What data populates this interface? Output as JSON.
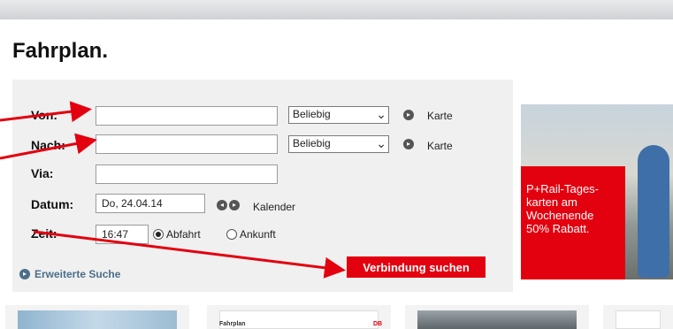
{
  "page": {
    "title": "Fahrplan."
  },
  "form": {
    "von_label": "Von:",
    "nach_label": "Nach:",
    "via_label": "Via:",
    "datum_label": "Datum:",
    "zeit_label": "Zeit:",
    "von_value": "",
    "nach_value": "",
    "via_value": "",
    "datum_value": "Do, 24.04.14",
    "zeit_value": "16:47",
    "select_von": "Beliebig",
    "select_nach": "Beliebig",
    "karte": "Karte",
    "kalender": "Kalender",
    "abfahrt": "Abfahrt",
    "ankunft": "Ankunft",
    "abfahrt_selected": true,
    "erweiterte_suche": "Erweiterte Suche",
    "submit": "Verbindung suchen"
  },
  "promo": {
    "text": "P+Rail-Tages-\nkarten am\nWochenende\n50% Rabatt."
  },
  "thumbnails": {
    "caption": "Fahrplan",
    "logo": "DB"
  },
  "colors": {
    "accent": "#e3000f",
    "panel": "#f0f0f0",
    "link": "#4b6e88"
  },
  "icons": {
    "arrow": "circle-arrow-icon",
    "chevron": "chevron-down-icon"
  }
}
